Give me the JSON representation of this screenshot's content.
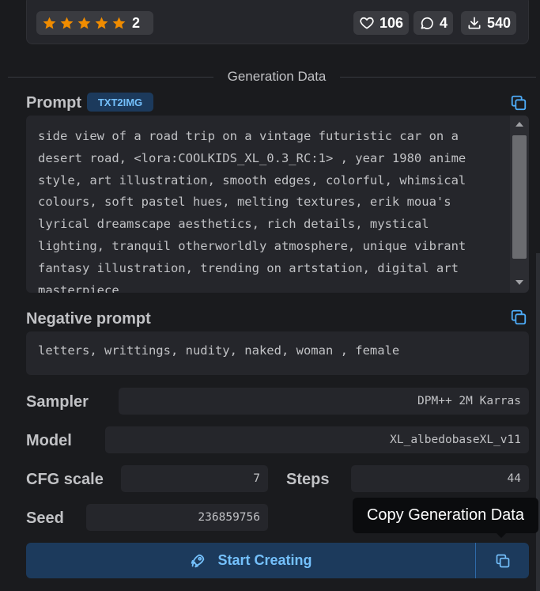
{
  "stats": {
    "rating_stars": 5,
    "rating_count": "2",
    "likes": "106",
    "comments": "4",
    "downloads": "540"
  },
  "divider_label": "Generation Data",
  "prompt": {
    "title": "Prompt",
    "badge": "TXT2IMG",
    "lines": [
      "side view of a road trip on a vintage futuristic car on a",
      "desert road, <lora:COOLKIDS_XL_0.3_RC:1> , year 1980 anime",
      "style, art illustration, smooth edges, colorful, whimsical",
      "colours, soft pastel hues, melting textures, erik moua's",
      "lyrical dreamscape aesthetics, rich details, mystical",
      "lighting, tranquil otherworldly atmosphere, unique vibrant",
      "fantasy illustration, trending on artstation, digital art",
      "masterpiece"
    ]
  },
  "negative": {
    "title": "Negative prompt",
    "text": "letters, writtings, nudity, naked, woman , female"
  },
  "params": {
    "sampler_label": "Sampler",
    "sampler_value": "DPM++ 2M Karras",
    "model_label": "Model",
    "model_value": "XL_albedobaseXL_v11",
    "cfg_label": "CFG scale",
    "cfg_value": "7",
    "steps_label": "Steps",
    "steps_value": "44",
    "seed_label": "Seed",
    "seed_value": "236859756"
  },
  "actions": {
    "start_label": "Start Creating",
    "tooltip": "Copy Generation Data"
  },
  "colors": {
    "background": "#1a1b1e",
    "card": "#25262b",
    "accent": "#74c0fc",
    "star": "#f08c00"
  }
}
